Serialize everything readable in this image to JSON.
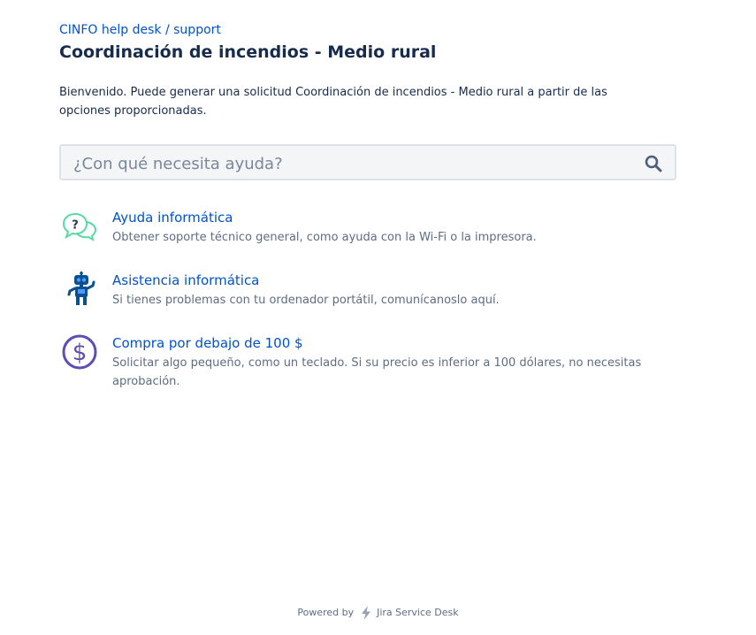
{
  "breadcrumb": {
    "portal": "CINFO help desk",
    "separator": " / ",
    "section": "support"
  },
  "header": {
    "title": "Coordinación de incendios - Medio rural"
  },
  "welcome": {
    "text": "Bienvenido. Puede generar una solicitud Coordinación de incendios - Medio rural a partir de las opciones proporcionadas."
  },
  "search": {
    "placeholder": "¿Con qué necesita ayuda?",
    "value": "",
    "icon": "search-icon"
  },
  "request_types": [
    {
      "title": "Ayuda informática",
      "description": "Obtener soporte técnico general, como ayuda con la Wi-Fi o la impresora.",
      "icon": "speech-bubbles-question-icon",
      "color": "#57d9a3"
    },
    {
      "title": "Asistencia informática",
      "description": "Si tienes problemas con tu ordenador portátil, comunícanoslo aquí.",
      "icon": "robot-icon",
      "color": "#0a4f8f"
    },
    {
      "title": "Compra por debajo de 100 $",
      "description": "Solicitar algo pequeño, como un teclado. Si su precio es inferior a 100 dólares, no necesitas aprobación.",
      "icon": "dollar-coin-icon",
      "color": "#5e4db2"
    }
  ],
  "footer": {
    "powered_by": "Powered by",
    "product": "Jira Service Desk",
    "icon": "jira-bolt-icon"
  },
  "colors": {
    "link": "#0052cc",
    "text": "#172b4d",
    "subtle_text": "#5e6c84",
    "search_bg": "#f4f5f7",
    "search_border": "#dfe1e6"
  }
}
